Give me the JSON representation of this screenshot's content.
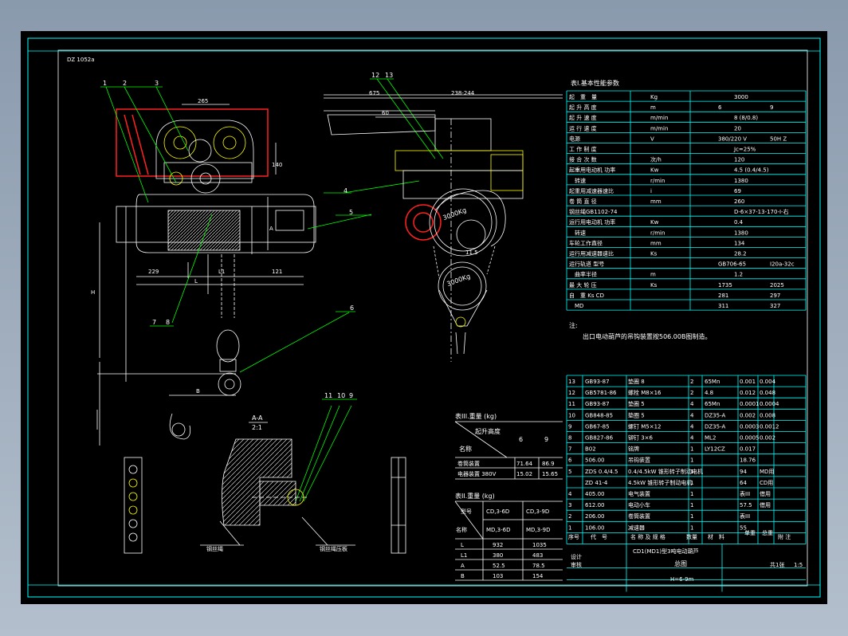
{
  "drawing": {
    "corner_label": "DZ 1052a",
    "balloons": [
      "1",
      "2",
      "3",
      "12",
      "13",
      "4",
      "5",
      "6",
      "7",
      "8",
      "11",
      "10",
      "9"
    ],
    "section_label": "A-A",
    "section_scale": "2:1",
    "note_left_a": "钢丝绳",
    "note_left_b": "钢丝绳压板",
    "pulley_label": "3000Kg",
    "dims": {
      "d1": "265",
      "d2": "140",
      "d3": "L1",
      "d4": "229",
      "d5": "L",
      "d6": "121",
      "d7": "B",
      "d8": "A",
      "d9": "H",
      "d10": "675",
      "d11": "238-244",
      "d12": "60",
      "d13": "11.5"
    }
  },
  "table1": {
    "title": "表I.基本性能参数",
    "rows": [
      [
        "起　重　量",
        "Kg",
        "3000",
        ""
      ],
      [
        "起 升 高 度",
        "m",
        "6",
        "9"
      ],
      [
        "起 升 速 度",
        "m/min",
        "8 (8/0.8)",
        ""
      ],
      [
        "运 行 速 度",
        "m/min",
        "20",
        ""
      ],
      [
        "电源",
        "V",
        "380/220 V",
        "50H Z"
      ],
      [
        "工 作 制 度",
        "",
        "Jc=25%",
        ""
      ],
      [
        "接 合 次 数",
        "次/h",
        "120",
        ""
      ],
      [
        "起重用电动机 功率",
        "Kw",
        "4.5 (0.4/4.5)",
        ""
      ],
      [
        "　转速",
        "r/min",
        "1380",
        ""
      ],
      [
        "起重用减速器速比",
        "i",
        "69",
        ""
      ],
      [
        "卷 筒 直 径",
        "mm",
        "260",
        ""
      ],
      [
        "钢丝绳GB1102-74",
        "",
        "D-6×37-13-170-I-右",
        ""
      ],
      [
        "运行用电动机 功率",
        "Kw",
        "0.4",
        ""
      ],
      [
        "　转速",
        "r/min",
        "1380",
        ""
      ],
      [
        "车轮工作直径",
        "mm",
        "134",
        ""
      ],
      [
        "运行用减速器速比",
        "Ks",
        "28.2",
        ""
      ],
      [
        "运行轨道 型号",
        "",
        "GB706-65",
        "I20a-32c"
      ],
      [
        "　曲率半径",
        "m",
        "1.2",
        ""
      ],
      [
        "最 大 轮 压",
        "Ks",
        "1735",
        "2025"
      ],
      [
        "自　重 Ks CD",
        "",
        "281",
        "297"
      ],
      [
        "　MD",
        "",
        "311",
        "327"
      ]
    ]
  },
  "note": {
    "head": "注:",
    "body": "出口电动葫芦的吊钩装置按506.00B图制造。"
  },
  "bom": {
    "rows": [
      [
        "13",
        "GB93-87",
        "垫圈 8",
        "2",
        "65Mn",
        "0.001",
        "0.004"
      ],
      [
        "12",
        "GB5781-86",
        "螺栓 M8×16",
        "2",
        "4.8",
        "0.012",
        "0.048"
      ],
      [
        "11",
        "GB93-87",
        "垫圈 5",
        "4",
        "65Mn",
        "0.0001",
        "0.0004"
      ],
      [
        "10",
        "GB848-85",
        "垫圈 5",
        "4",
        "DZ35-A",
        "0.002",
        "0.008"
      ],
      [
        "9",
        "GB67-85",
        "螺钉 M5×12",
        "4",
        "DZ35-A",
        "0.0003",
        "0.0012"
      ],
      [
        "8",
        "GB827-86",
        "铆钉 3×6",
        "4",
        "ML2",
        "0.0005",
        "0.002"
      ],
      [
        "7",
        "B02",
        "铭牌",
        "1",
        "LY12CZ",
        "0.017",
        ""
      ],
      [
        "6",
        "506.00",
        "吊钩装置",
        "1",
        "",
        "18.76",
        ""
      ],
      [
        "5",
        "ZDS 0.4/4.5",
        "0.4/4.5kW 锥形转子制动电机",
        "1",
        "",
        "94",
        "MD用"
      ],
      [
        "",
        "ZD 41-4",
        "4.5kW 锥形转子制动电机",
        "1",
        "",
        "64",
        "CD用"
      ],
      [
        "4",
        "405.00",
        "电气装置",
        "1",
        "",
        "表III",
        "借用"
      ],
      [
        "3",
        "612.00",
        "电动小车",
        "1",
        "",
        "57.5",
        "借用"
      ],
      [
        "2",
        "206.00",
        "卷筒装置",
        "1",
        "",
        "表III",
        ""
      ],
      [
        "1",
        "106.00",
        "减速器",
        "1",
        "",
        "55",
        ""
      ]
    ],
    "header": [
      "序号",
      "代　号",
      "名 称 及 规 格",
      "数量",
      "材　料",
      "单重",
      "总重",
      "附 注"
    ],
    "title_block": {
      "product": "CD1(MD1)型3吨电动葫芦",
      "view": "总图",
      "code": "H=6-9m",
      "scale": "1:5",
      "sheet": "共1张",
      "design": "设计",
      "check": "审核"
    }
  },
  "table3": {
    "title": "表III.重量 (kg)",
    "head_a": "起升高度",
    "head_b": "名称",
    "cols": [
      "6",
      "9"
    ],
    "rows": [
      [
        "卷筒装置",
        "71.64",
        "86.9"
      ],
      [
        "电器装置 380V",
        "15.02",
        "15.65"
      ]
    ]
  },
  "table2": {
    "title": "表II.重量 (kg)",
    "head_a": "型号",
    "head_b": "名称",
    "cols": [
      "CD,3-6D",
      "CD,3-9D",
      "MD,3-6D",
      "MD,3-9D"
    ],
    "rows": [
      [
        "L",
        "932",
        "1035"
      ],
      [
        "L1",
        "380",
        "483"
      ],
      [
        "A",
        "52.5",
        "78.5"
      ],
      [
        "B",
        "103",
        "154"
      ]
    ]
  },
  "colors": {
    "sheet": "#000000",
    "frame": "#00ffff",
    "lines": "#ffffff",
    "leaders": "#00ff00",
    "accent": "#ffff00",
    "red": "#ff2020"
  }
}
